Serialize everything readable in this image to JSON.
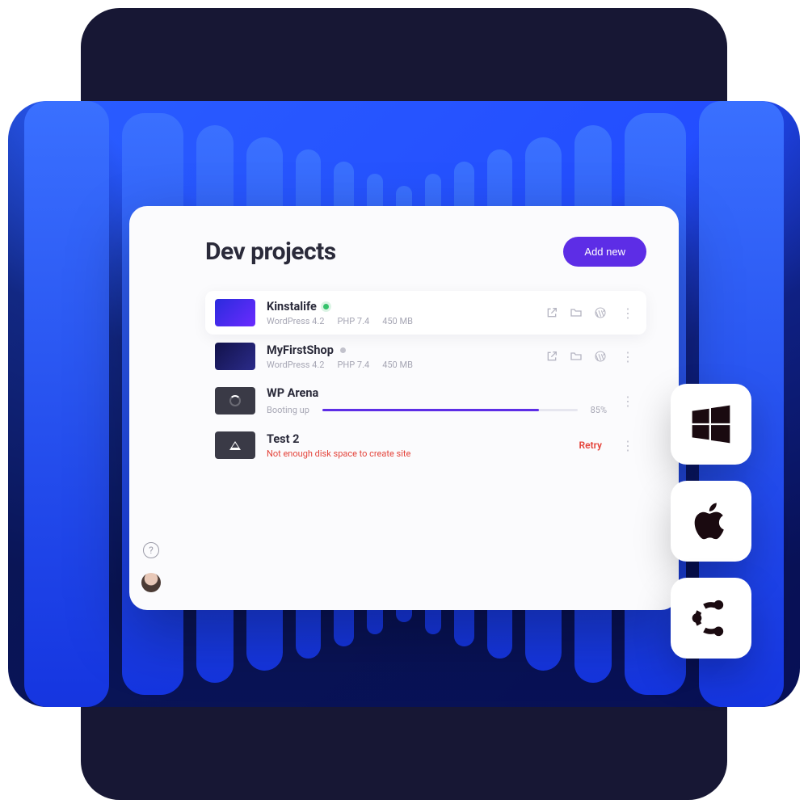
{
  "header": {
    "title": "Dev projects",
    "add_button": "Add new"
  },
  "projects": [
    {
      "name": "Kinstalife",
      "status": "running",
      "meta": {
        "cms": "WordPress 4.2",
        "php": "PHP 7.4",
        "size": "450 MB"
      }
    },
    {
      "name": "MyFirstShop",
      "status": "idle",
      "meta": {
        "cms": "WordPress 4.2",
        "php": "PHP 7.4",
        "size": "450 MB"
      }
    },
    {
      "name": "WP Arena",
      "status": "booting",
      "sub": "Booting up",
      "progress_pct": "85%",
      "progress_value": 85
    },
    {
      "name": "Test 2",
      "status": "error",
      "sub": "Not enough disk space to create site",
      "retry_label": "Retry"
    }
  ],
  "os_icons": [
    "windows",
    "apple",
    "ubuntu"
  ]
}
